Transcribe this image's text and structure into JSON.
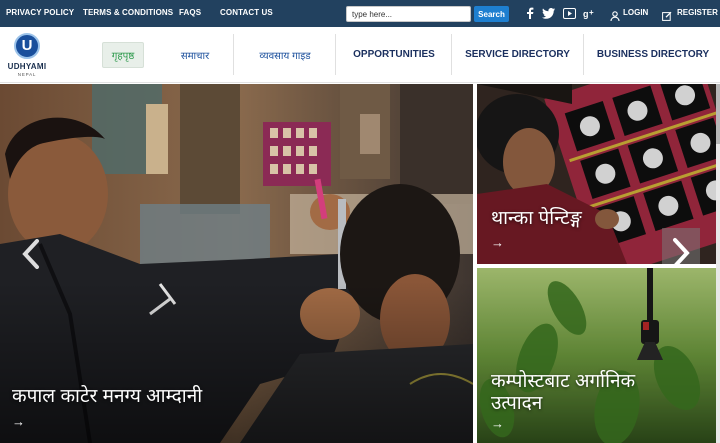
{
  "topbar": {
    "links": [
      "PRIVACY POLICY",
      "TERMS & CONDITIONS",
      "FAQS",
      "CONTACT US"
    ],
    "search": {
      "placeholder": "type here...",
      "button": "Search"
    },
    "social_icons": [
      "facebook-icon",
      "twitter-icon",
      "youtube-icon",
      "google-plus-icon"
    ],
    "login": "LOGIN",
    "register": "REGISTER"
  },
  "logo": {
    "name": "UDHYAMI",
    "sub": "NEPAL",
    "letter": "U"
  },
  "nav": {
    "items": [
      "गृहपृष्ठ",
      "समाचार",
      "व्यवसाय गाइड",
      "OPPORTUNITIES",
      "SERVICE DIRECTORY",
      "BUSINESS DIRECTORY"
    ],
    "active_index": 0
  },
  "hero": {
    "main": {
      "title": "कपाल काटेर मनग्य आम्दानी",
      "arrow": "→"
    },
    "side_top": {
      "title": "थान्का पेन्टिङ्ग",
      "arrow": "→"
    },
    "side_bottom": {
      "title_line1": "कम्पोस्टबाट अर्गानिक",
      "title_line2": "उत्पादन",
      "arrow": "→"
    }
  },
  "colors": {
    "topbar": "#22415f",
    "search_button": "#1e7fd0",
    "nav_text": "#1a4f9c",
    "nav_active": "#2e9a4d"
  }
}
